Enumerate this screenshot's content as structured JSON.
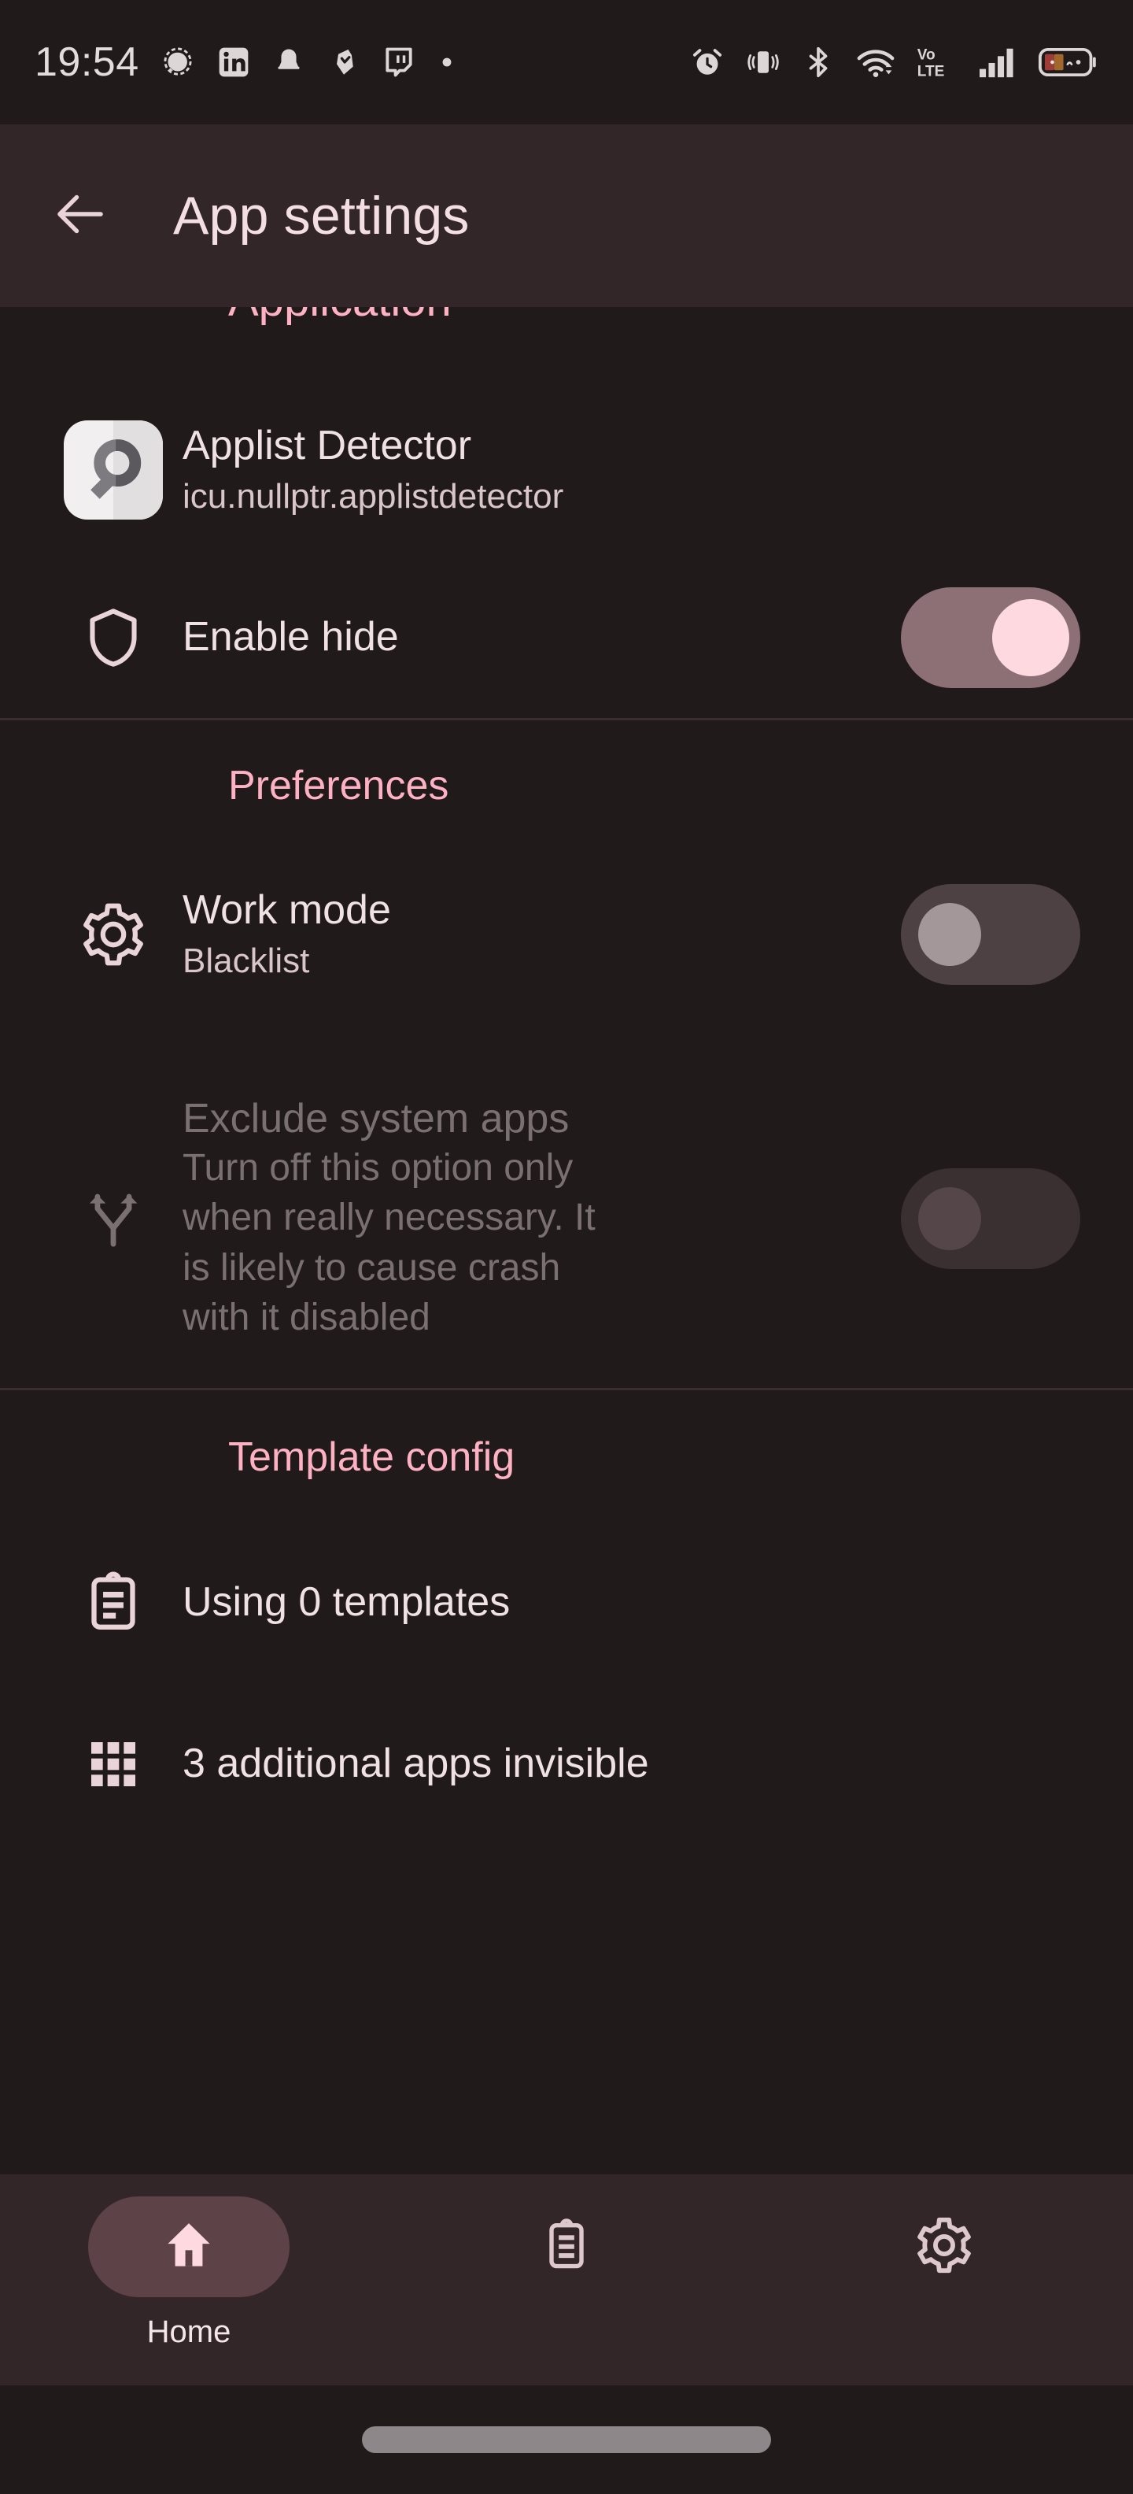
{
  "statusbar": {
    "time": "19:54",
    "left_icons": [
      "signal-messenger-icon",
      "linkedin-icon",
      "notification-bell-icon",
      "shield-heart-icon",
      "twitch-icon",
      "dot-icon"
    ],
    "right_icons": [
      "alarm-clock-icon",
      "vibrate-icon",
      "bluetooth-icon",
      "wifi-icon",
      "volte-icon",
      "cellular-signal-icon",
      "battery-icon"
    ],
    "volte_label_top": "Vo",
    "volte_label_bottom": "LTE"
  },
  "appbar": {
    "back_icon": "back-arrow-icon",
    "title": "App settings"
  },
  "content": {
    "cut_section_header": "Application",
    "app": {
      "name": "Applist Detector",
      "package": "icu.nullptr.applistdetector",
      "icon": "magnifier-app-icon"
    },
    "enable_hide": {
      "icon": "shield-icon",
      "title": "Enable hide",
      "toggle_state": "on"
    },
    "preferences_header": "Preferences",
    "work_mode": {
      "icon": "gear-icon",
      "title": "Work mode",
      "subtitle": "Blacklist",
      "toggle_state": "off"
    },
    "exclude_system_apps": {
      "icon": "fork-branch-icon",
      "title": "Exclude system apps",
      "description": "Turn off this option only when really necessary. It is likely to cause crash with it disabled",
      "toggle_state": "off",
      "disabled": true
    },
    "template_header": "Template config",
    "using_templates": {
      "icon": "clipboard-list-icon",
      "title": "Using 0 templates"
    },
    "additional_apps": {
      "icon": "grid-apps-icon",
      "title": "3 additional apps invisible"
    }
  },
  "bottomnav": {
    "items": [
      {
        "label": "Home",
        "icon": "home-icon",
        "active": true
      },
      {
        "label": "",
        "icon": "clipboard-list-icon",
        "active": false
      },
      {
        "label": "",
        "icon": "gear-icon",
        "active": false
      }
    ]
  },
  "colors": {
    "background": "#211a1b",
    "surface": "#332629",
    "accent_pink": "#ffb1c4",
    "text_primary": "#f0e2e4",
    "text_secondary": "#d8c6c9",
    "text_disabled": "#7b7071",
    "toggle_on_track": "#8d7076",
    "toggle_on_thumb": "#ffd9e0"
  }
}
